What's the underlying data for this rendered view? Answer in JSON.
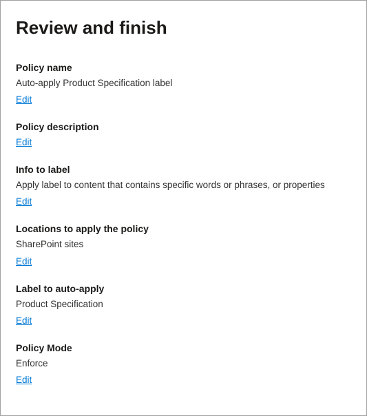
{
  "title": "Review and finish",
  "editLabel": "Edit",
  "sections": {
    "policyName": {
      "label": "Policy name",
      "value": "Auto-apply Product Specification label"
    },
    "policyDescription": {
      "label": "Policy description",
      "value": ""
    },
    "infoToLabel": {
      "label": "Info to label",
      "value": "Apply label to content that contains specific words or phrases, or properties"
    },
    "locations": {
      "label": "Locations to apply the policy",
      "value": "SharePoint sites"
    },
    "labelToApply": {
      "label": "Label to auto-apply",
      "value": "Product Specification"
    },
    "policyMode": {
      "label": "Policy Mode",
      "value": "Enforce"
    }
  }
}
